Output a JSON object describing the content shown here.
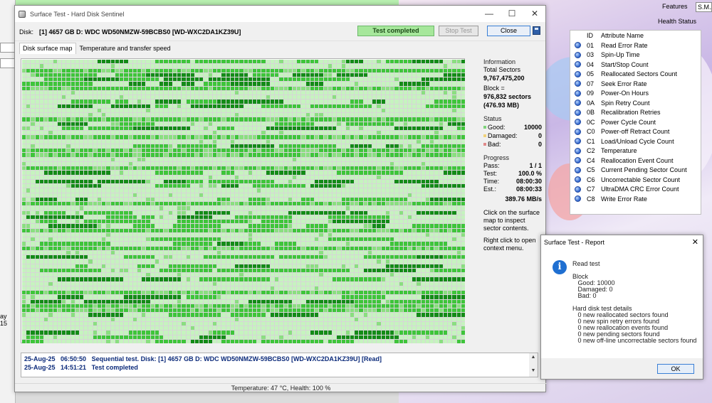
{
  "window": {
    "title": "Surface Test - Hard Disk Sentinel",
    "disk_label": "Disk:",
    "disk_value": "[1] 4657 GB D: WDC WD50NMZW-59BCBS0 [WD-WXC2DA1KZ39U]",
    "status_badge": "Test completed",
    "stop_button": "Stop Test",
    "close_button": "Close",
    "tabs": [
      "Disk surface map",
      "Temperature and transfer speed"
    ]
  },
  "side": {
    "info_header": "Information",
    "total_sectors_label": "Total Sectors",
    "total_sectors": "9,767,475,200",
    "block_label": "Block =",
    "block_sectors": "976,832 sectors",
    "block_size": "(476.93 MB)",
    "status_header": "Status",
    "good_label": "Good:",
    "good_value": "10000",
    "damaged_label": "Damaged:",
    "damaged_value": "0",
    "bad_label": "Bad:",
    "bad_value": "0",
    "progress_header": "Progress",
    "pass_label": "Pass:",
    "pass_value": "1 / 1",
    "test_label": "Test:",
    "test_value": "100.0 %",
    "time_label": "Time:",
    "time_value": "08:00:30",
    "est_label": "Est.:",
    "est_value": "08:00:33",
    "speed": "389.76 MB/s",
    "hint1": "Click on the surface map to inspect sector contents.",
    "hint2": "Right click to open context menu."
  },
  "log": [
    {
      "date": "25-Aug-25",
      "time": "06:50:50",
      "message": "Sequential test. Disk: [1] 4657 GB D: WDC WD50NMZW-59BCBS0 [WD-WXC2DA1KZ39U] [Read]"
    },
    {
      "date": "25-Aug-25",
      "time": "14:51:21",
      "message": "Test completed"
    }
  ],
  "status_strip": "Temperature: 47 °C, Health: 100 %",
  "smart": {
    "features_label": "Features",
    "features_value": "S.M.A",
    "health_label": "Health Status",
    "col_id": "ID",
    "col_attr": "Attribute Name",
    "rows": [
      {
        "id": "01",
        "name": "Read Error Rate"
      },
      {
        "id": "03",
        "name": "Spin-Up Time"
      },
      {
        "id": "04",
        "name": "Start/Stop Count"
      },
      {
        "id": "05",
        "name": "Reallocated Sectors Count"
      },
      {
        "id": "07",
        "name": "Seek Error Rate"
      },
      {
        "id": "09",
        "name": "Power-On Hours"
      },
      {
        "id": "0A",
        "name": "Spin Retry Count"
      },
      {
        "id": "0B",
        "name": "Recalibration Retries"
      },
      {
        "id": "0C",
        "name": "Power Cycle Count"
      },
      {
        "id": "C0",
        "name": "Power-off Retract Count"
      },
      {
        "id": "C1",
        "name": "Load/Unload Cycle Count"
      },
      {
        "id": "C2",
        "name": "Temperature"
      },
      {
        "id": "C4",
        "name": "Reallocation Event Count"
      },
      {
        "id": "C5",
        "name": "Current Pending Sector Count"
      },
      {
        "id": "C6",
        "name": "Uncorrectable Sector Count"
      },
      {
        "id": "C7",
        "name": "UltraDMA CRC Error Count"
      },
      {
        "id": "C8",
        "name": "Write Error Rate"
      }
    ]
  },
  "dialog": {
    "title": "Surface Test - Report",
    "lines": [
      "Read test",
      "",
      "Block",
      "   Good: 10000",
      "   Damaged: 0",
      "   Bad: 0",
      "",
      "Hard disk test details",
      "   0 new reallocated sectors found",
      "   0 new spin retry errors found",
      "   0 new reallocation events found",
      "   0 new pending sectors found",
      "   0 new off-line uncorrectable sectors found"
    ],
    "ok_button": "OK"
  },
  "left_strip": {
    "fragment_text": "ay 15"
  },
  "colors": {
    "good_light": "#c6f3bf",
    "good_mid": "#3ec53a",
    "good_dark": "#138b17",
    "status_badge": "#a6e79b"
  }
}
